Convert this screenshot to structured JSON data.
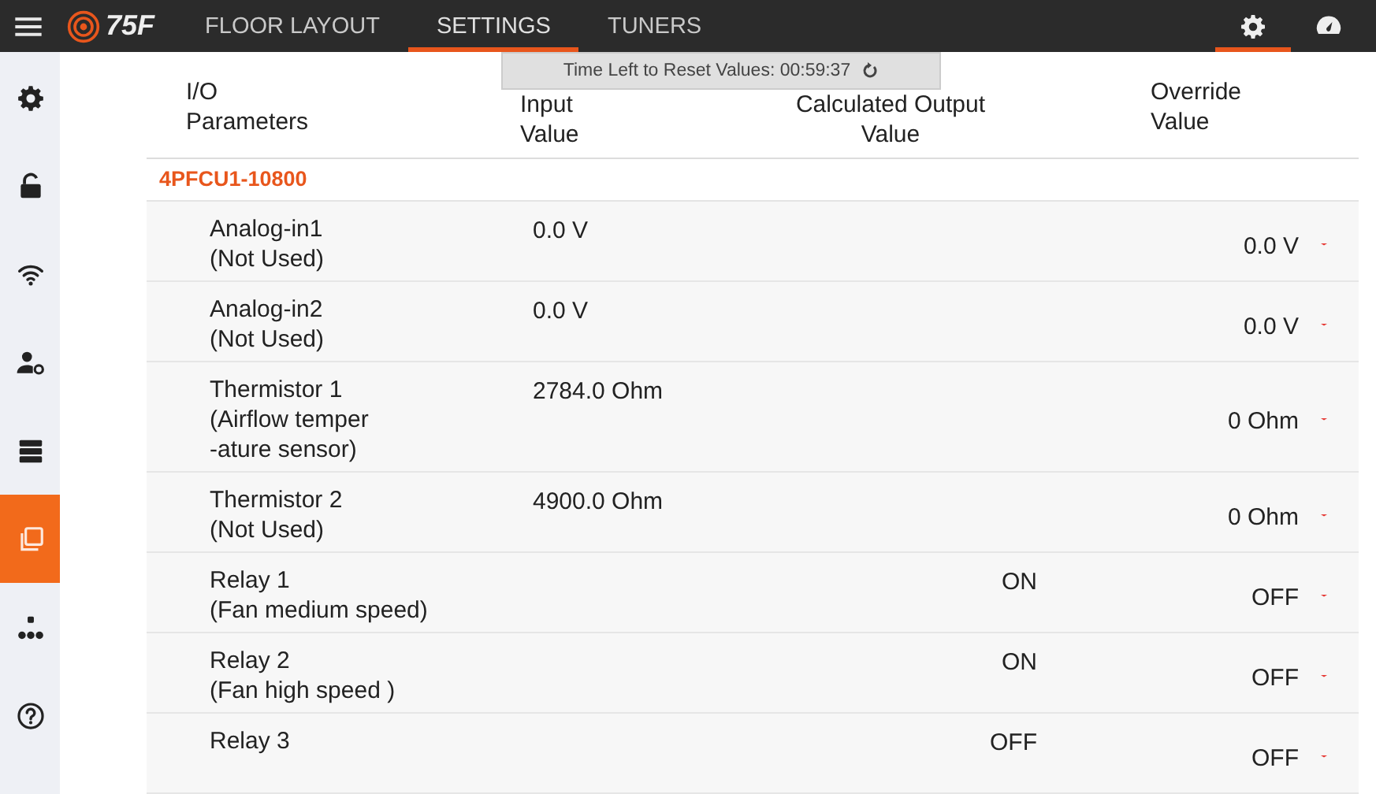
{
  "top_bar": {
    "logo": "75F",
    "tabs": [
      {
        "label": "FLOOR LAYOUT",
        "selected": false
      },
      {
        "label": "SETTINGS",
        "selected": true
      },
      {
        "label": "TUNERS",
        "selected": false
      }
    ],
    "actions": [
      {
        "kind": "settings",
        "selected": true
      },
      {
        "kind": "dashboard",
        "selected": false
      }
    ]
  },
  "sidebar": {
    "items": [
      {
        "kind": "gear",
        "selected": false
      },
      {
        "kind": "lock",
        "selected": false
      },
      {
        "kind": "wifi",
        "selected": false
      },
      {
        "kind": "user",
        "selected": false
      },
      {
        "kind": "server",
        "selected": false
      },
      {
        "kind": "copy",
        "selected": true
      },
      {
        "kind": "network",
        "selected": false
      },
      {
        "kind": "help",
        "selected": false
      }
    ]
  },
  "timer": {
    "label": "Time Left to Reset Values:",
    "value": "00:59:37"
  },
  "table": {
    "columns": [
      {
        "line1": "I/O",
        "line2": "Parameters"
      },
      {
        "line1": "Input",
        "line2": "Value"
      },
      {
        "line1": "Calculated Output",
        "line2": "Value"
      },
      {
        "line1": "Override",
        "line2": "Value"
      }
    ],
    "group": "4PFCU1-10800",
    "rows": [
      {
        "name": "Analog-in1",
        "note": "(Not Used)",
        "input": "0.0 V",
        "override": "0.0 V"
      },
      {
        "name": "Analog-in2",
        "note": "(Not Used)",
        "input": "0.0 V",
        "override": "0.0 V"
      },
      {
        "name": "Thermistor 1",
        "note": "(Airflow temper\n-ature sensor)",
        "input": "2784.0 Ohm",
        "override": "0 Ohm"
      },
      {
        "name": "Thermistor 2",
        "note": "(Not Used)",
        "input": "4900.0 Ohm",
        "override": "0 Ohm"
      },
      {
        "name": "Relay 1",
        "note": "(Fan medium speed)",
        "output": "ON",
        "override": "OFF"
      },
      {
        "name": "Relay 2",
        "note": "(Fan high speed )",
        "output": "ON",
        "override": "OFF"
      },
      {
        "name": "Relay 3",
        "output": "OFF",
        "override": "OFF"
      }
    ]
  }
}
